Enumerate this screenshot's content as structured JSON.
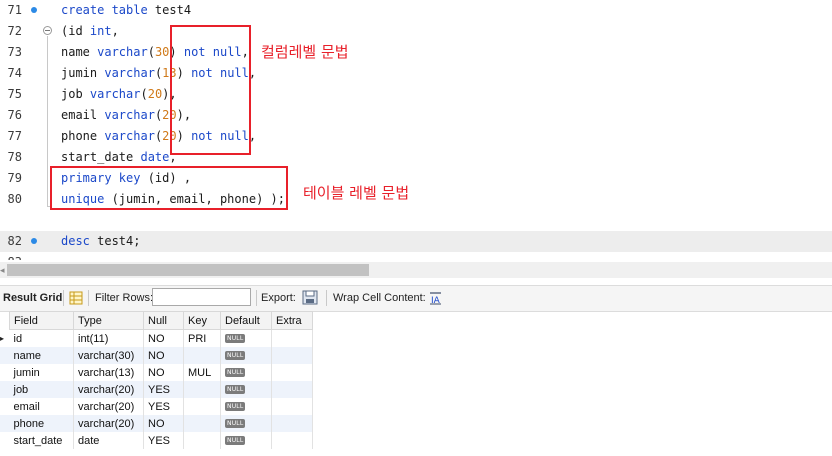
{
  "editor": {
    "lines": [
      {
        "num": "71",
        "marker": true,
        "fold": false,
        "segs": [
          [
            "kw",
            "create table "
          ],
          [
            "t",
            "test4"
          ]
        ]
      },
      {
        "num": "72",
        "marker": false,
        "fold": true,
        "segs": [
          [
            "t",
            "(id "
          ],
          [
            "kw",
            "int"
          ],
          [
            "t",
            ","
          ]
        ]
      },
      {
        "num": "73",
        "marker": false,
        "fold": false,
        "segs": [
          [
            "t",
            "name "
          ],
          [
            "kw",
            "varchar"
          ],
          [
            "t",
            "("
          ],
          [
            "num",
            "30"
          ],
          [
            "t",
            ") "
          ],
          [
            "kw",
            "not null"
          ],
          [
            "t",
            ","
          ]
        ]
      },
      {
        "num": "74",
        "marker": false,
        "fold": false,
        "segs": [
          [
            "t",
            "jumin "
          ],
          [
            "kw",
            "varchar"
          ],
          [
            "t",
            "("
          ],
          [
            "num",
            "13"
          ],
          [
            "t",
            ") "
          ],
          [
            "kw",
            "not null"
          ],
          [
            "t",
            ","
          ]
        ]
      },
      {
        "num": "75",
        "marker": false,
        "fold": false,
        "segs": [
          [
            "t",
            "job "
          ],
          [
            "kw",
            "varchar"
          ],
          [
            "t",
            "("
          ],
          [
            "num",
            "20"
          ],
          [
            "t",
            "),"
          ]
        ]
      },
      {
        "num": "76",
        "marker": false,
        "fold": false,
        "segs": [
          [
            "t",
            "email "
          ],
          [
            "kw",
            "varchar"
          ],
          [
            "t",
            "("
          ],
          [
            "num",
            "20"
          ],
          [
            "t",
            "),"
          ]
        ]
      },
      {
        "num": "77",
        "marker": false,
        "fold": false,
        "segs": [
          [
            "t",
            "phone "
          ],
          [
            "kw",
            "varchar"
          ],
          [
            "t",
            "("
          ],
          [
            "num",
            "20"
          ],
          [
            "t",
            ") "
          ],
          [
            "kw",
            "not null"
          ],
          [
            "t",
            ","
          ]
        ]
      },
      {
        "num": "78",
        "marker": false,
        "fold": false,
        "segs": [
          [
            "t",
            "start_date "
          ],
          [
            "kw",
            "date"
          ],
          [
            "t",
            ","
          ]
        ]
      },
      {
        "num": "79",
        "marker": false,
        "fold": false,
        "segs": [
          [
            "kw",
            "primary key"
          ],
          [
            "t",
            " (id) ,"
          ]
        ]
      },
      {
        "num": "80",
        "marker": false,
        "fold": false,
        "segs": [
          [
            "kw",
            "unique"
          ],
          [
            "t",
            " (jumin, email, phone) );"
          ]
        ]
      },
      {
        "num": "",
        "marker": false,
        "fold": false,
        "segs": []
      },
      {
        "num": "82",
        "marker": true,
        "fold": false,
        "active": true,
        "segs": [
          [
            "kw",
            "desc"
          ],
          [
            "t",
            " test4;"
          ]
        ]
      },
      {
        "num": "83",
        "marker": false,
        "fold": false,
        "segs": []
      }
    ],
    "annotations": {
      "column_level": "컬럼레벨 문법",
      "table_level": "테이블 레벨 문법"
    },
    "annotation_color": "#e8202a"
  },
  "toolbar": {
    "result_grid": "Result Grid",
    "filter_rows": "Filter Rows:",
    "filter_value": "",
    "export": "Export:",
    "wrap_cell": "Wrap Cell Content:",
    "icons": [
      "grid-form-icon",
      "export-icon",
      "wrap-text-icon"
    ]
  },
  "grid": {
    "columns": [
      "Field",
      "Type",
      "Null",
      "Key",
      "Default",
      "Extra"
    ],
    "null_label": "NULL",
    "rows": [
      {
        "Field": "id",
        "Type": "int(11)",
        "Null": "NO",
        "Key": "PRI",
        "Default": "NULL",
        "Extra": ""
      },
      {
        "Field": "name",
        "Type": "varchar(30)",
        "Null": "NO",
        "Key": "",
        "Default": "NULL",
        "Extra": ""
      },
      {
        "Field": "jumin",
        "Type": "varchar(13)",
        "Null": "NO",
        "Key": "MUL",
        "Default": "NULL",
        "Extra": ""
      },
      {
        "Field": "job",
        "Type": "varchar(20)",
        "Null": "YES",
        "Key": "",
        "Default": "NULL",
        "Extra": ""
      },
      {
        "Field": "email",
        "Type": "varchar(20)",
        "Null": "YES",
        "Key": "",
        "Default": "NULL",
        "Extra": ""
      },
      {
        "Field": "phone",
        "Type": "varchar(20)",
        "Null": "NO",
        "Key": "",
        "Default": "NULL",
        "Extra": ""
      },
      {
        "Field": "start_date",
        "Type": "date",
        "Null": "YES",
        "Key": "",
        "Default": "NULL",
        "Extra": ""
      }
    ]
  }
}
